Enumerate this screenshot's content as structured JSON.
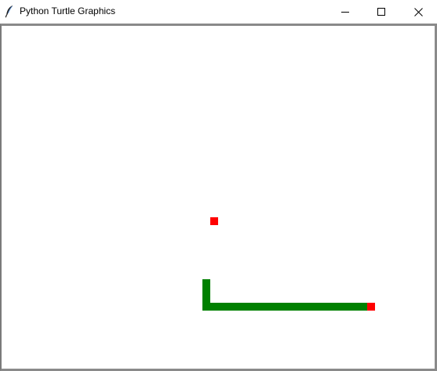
{
  "window": {
    "title": "Python Turtle Graphics",
    "icon": "feather-icon"
  },
  "controls": {
    "minimize_icon": "minimize-icon",
    "maximize_icon": "maximize-icon",
    "close_icon": "close-icon"
  },
  "canvas": {
    "background": "#ffffff",
    "food_color": "#ff0000",
    "snake_body_color": "#008000",
    "snake_head_color": "#ff0000"
  }
}
